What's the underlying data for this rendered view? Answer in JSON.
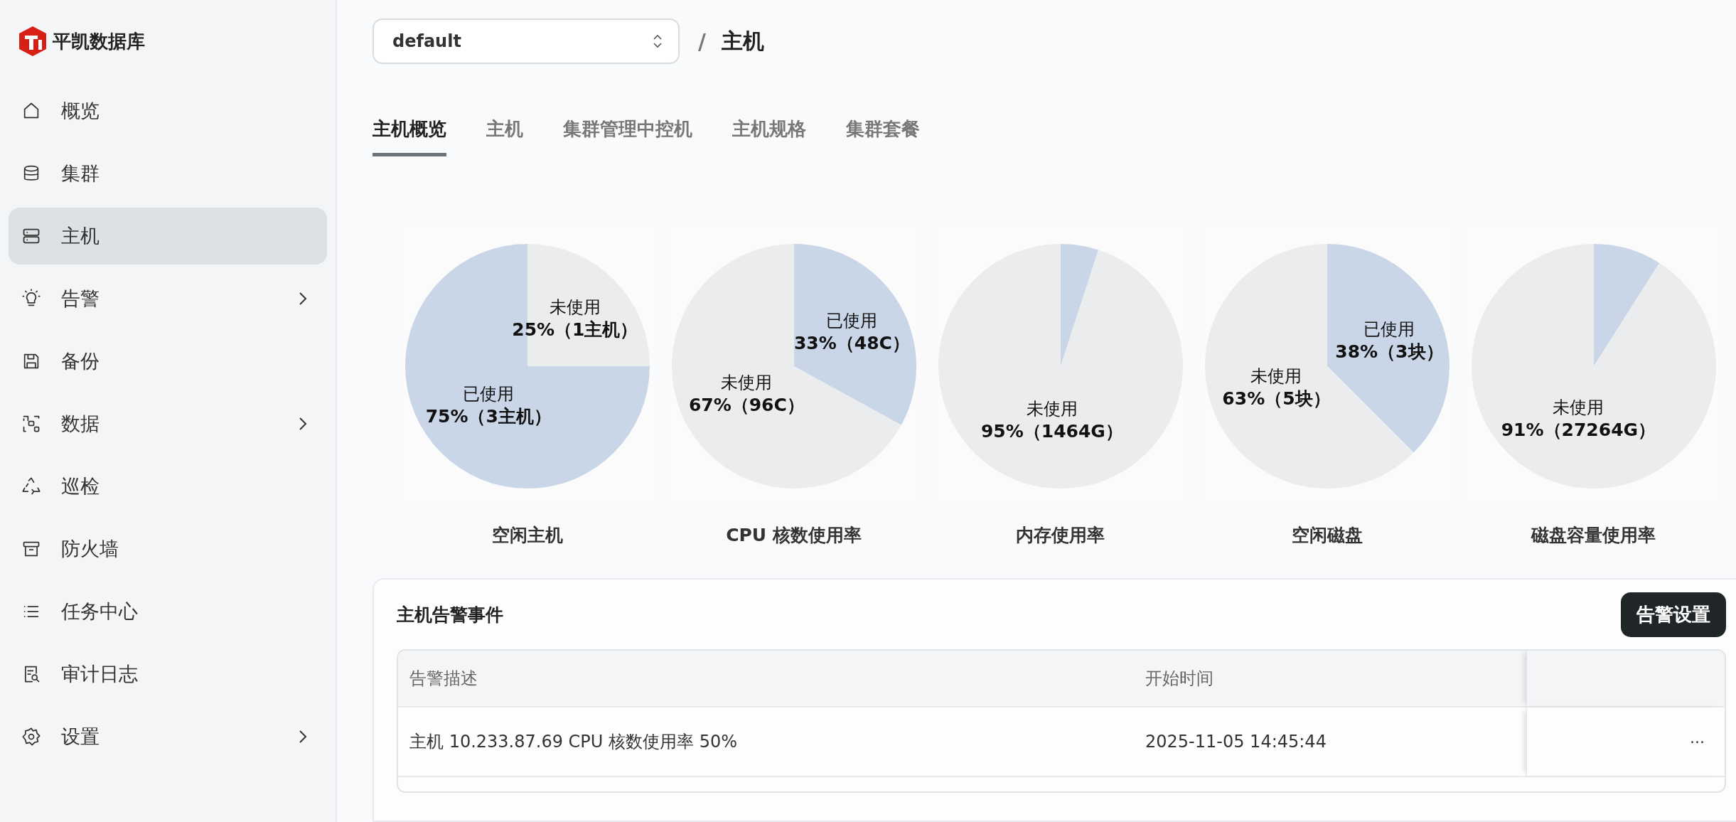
{
  "brand": {
    "name": "平凯数据库"
  },
  "sidebar": {
    "items": [
      {
        "label": "概览",
        "selected": false,
        "expandable": false
      },
      {
        "label": "集群",
        "selected": false,
        "expandable": false
      },
      {
        "label": "主机",
        "selected": true,
        "expandable": false
      },
      {
        "label": "告警",
        "selected": false,
        "expandable": true
      },
      {
        "label": "备份",
        "selected": false,
        "expandable": false
      },
      {
        "label": "数据",
        "selected": false,
        "expandable": true
      },
      {
        "label": "巡检",
        "selected": false,
        "expandable": false
      },
      {
        "label": "防火墙",
        "selected": false,
        "expandable": false
      },
      {
        "label": "任务中心",
        "selected": false,
        "expandable": false
      },
      {
        "label": "审计日志",
        "selected": false,
        "expandable": false
      },
      {
        "label": "设置",
        "selected": false,
        "expandable": true
      }
    ]
  },
  "header": {
    "select_value": "default",
    "separator": "/",
    "page_title": "主机"
  },
  "tabs": [
    {
      "label": "主机概览",
      "selected": true
    },
    {
      "label": "主机",
      "selected": false
    },
    {
      "label": "集群管理中控机",
      "selected": false
    },
    {
      "label": "主机规格",
      "selected": false
    },
    {
      "label": "集群套餐",
      "selected": false
    }
  ],
  "charts": [
    {
      "title": "空闲主机",
      "chart_data": {
        "type": "pie",
        "categories": [
          "未使用",
          "已使用"
        ],
        "values": [
          25,
          75
        ],
        "colors": [
          "#ebecee",
          "#c9d6e7"
        ],
        "value_labels": [
          "25%（1主机）",
          "75%（3主机）"
        ]
      }
    },
    {
      "title": "CPU 核数使用率",
      "chart_data": {
        "type": "pie",
        "categories": [
          "已使用",
          "未使用"
        ],
        "values": [
          33,
          67
        ],
        "colors": [
          "#c9d6e7",
          "#ebecee"
        ],
        "value_labels": [
          "33%（48C）",
          "67%（96C）"
        ]
      }
    },
    {
      "title": "内存使用率",
      "chart_data": {
        "type": "pie",
        "categories": [
          null,
          "未使用"
        ],
        "values": [
          5,
          95
        ],
        "colors": [
          "#c9d6e7",
          "#ebecee"
        ],
        "value_labels": [
          null,
          "95%（1464G）"
        ]
      }
    },
    {
      "title": "空闲磁盘",
      "chart_data": {
        "type": "pie",
        "categories": [
          "已使用",
          "未使用"
        ],
        "values": [
          37.5,
          62.5
        ],
        "colors": [
          "#c9d6e7",
          "#ebecee"
        ],
        "value_labels": [
          "38%（3块）",
          "63%（5块）"
        ]
      }
    },
    {
      "title": "磁盘容量使用率",
      "chart_data": {
        "type": "pie",
        "categories": [
          null,
          "未使用"
        ],
        "values": [
          9,
          91
        ],
        "colors": [
          "#c9d6e7",
          "#ebecee"
        ],
        "value_labels": [
          null,
          "91%（27264G）"
        ]
      }
    }
  ],
  "alerts": {
    "title": "主机告警事件",
    "settings_button": "告警设置",
    "table": {
      "columns": [
        "告警描述",
        "开始时间"
      ],
      "rows": [
        {
          "cells": [
            "主机 10.233.87.69 CPU 核数使用率 50%",
            "2025-11-05 14:45:44"
          ],
          "actions": "···"
        }
      ]
    }
  }
}
